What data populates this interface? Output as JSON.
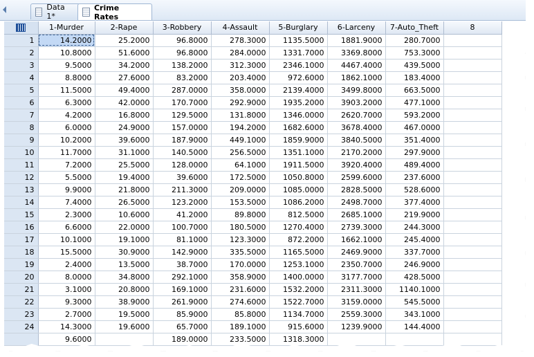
{
  "tabs": [
    {
      "label": "Data 1*"
    },
    {
      "label": "Crime Rates"
    }
  ],
  "columns": [
    "1-Murder",
    "2-Rape",
    "3-Robbery",
    "4-Assault",
    "5-Burglary",
    "6-Larceny",
    "7-Auto_Theft",
    "8"
  ],
  "rows": [
    {
      "n": "1",
      "v": [
        "14.2000",
        "25.2000",
        "96.8000",
        "278.3000",
        "1135.5000",
        "1881.9000",
        "280.7000",
        ""
      ]
    },
    {
      "n": "2",
      "v": [
        "10.8000",
        "51.6000",
        "96.8000",
        "284.0000",
        "1331.7000",
        "3369.8000",
        "753.3000",
        ""
      ]
    },
    {
      "n": "3",
      "v": [
        "9.5000",
        "34.2000",
        "138.2000",
        "312.3000",
        "2346.1000",
        "4467.4000",
        "439.5000",
        ""
      ]
    },
    {
      "n": "4",
      "v": [
        "8.8000",
        "27.6000",
        "83.2000",
        "203.4000",
        "972.6000",
        "1862.1000",
        "183.4000",
        ""
      ]
    },
    {
      "n": "5",
      "v": [
        "11.5000",
        "49.4000",
        "287.0000",
        "358.0000",
        "2139.4000",
        "3499.8000",
        "663.5000",
        ""
      ]
    },
    {
      "n": "6",
      "v": [
        "6.3000",
        "42.0000",
        "170.7000",
        "292.9000",
        "1935.2000",
        "3903.2000",
        "477.1000",
        ""
      ]
    },
    {
      "n": "7",
      "v": [
        "4.2000",
        "16.8000",
        "129.5000",
        "131.8000",
        "1346.0000",
        "2620.7000",
        "593.2000",
        ""
      ]
    },
    {
      "n": "8",
      "v": [
        "6.0000",
        "24.9000",
        "157.0000",
        "194.2000",
        "1682.6000",
        "3678.4000",
        "467.0000",
        ""
      ]
    },
    {
      "n": "9",
      "v": [
        "10.2000",
        "39.6000",
        "187.9000",
        "449.1000",
        "1859.9000",
        "3840.5000",
        "351.4000",
        ""
      ]
    },
    {
      "n": "10",
      "v": [
        "11.7000",
        "31.1000",
        "140.5000",
        "256.5000",
        "1351.1000",
        "2170.2000",
        "297.9000",
        ""
      ]
    },
    {
      "n": "11",
      "v": [
        "7.2000",
        "25.5000",
        "128.0000",
        "64.1000",
        "1911.5000",
        "3920.4000",
        "489.4000",
        ""
      ]
    },
    {
      "n": "12",
      "v": [
        "5.5000",
        "19.4000",
        "39.6000",
        "172.5000",
        "1050.8000",
        "2599.6000",
        "237.6000",
        ""
      ]
    },
    {
      "n": "13",
      "v": [
        "9.9000",
        "21.8000",
        "211.3000",
        "209.0000",
        "1085.0000",
        "2828.5000",
        "528.6000",
        ""
      ]
    },
    {
      "n": "14",
      "v": [
        "7.4000",
        "26.5000",
        "123.2000",
        "153.5000",
        "1086.2000",
        "2498.7000",
        "377.4000",
        ""
      ]
    },
    {
      "n": "15",
      "v": [
        "2.3000",
        "10.6000",
        "41.2000",
        "89.8000",
        "812.5000",
        "2685.1000",
        "219.9000",
        ""
      ]
    },
    {
      "n": "16",
      "v": [
        "6.6000",
        "22.0000",
        "100.7000",
        "180.5000",
        "1270.4000",
        "2739.3000",
        "244.3000",
        ""
      ]
    },
    {
      "n": "17",
      "v": [
        "10.1000",
        "19.1000",
        "81.1000",
        "123.3000",
        "872.2000",
        "1662.1000",
        "245.4000",
        ""
      ]
    },
    {
      "n": "18",
      "v": [
        "15.5000",
        "30.9000",
        "142.9000",
        "335.5000",
        "1165.5000",
        "2469.9000",
        "337.7000",
        ""
      ]
    },
    {
      "n": "19",
      "v": [
        "2.4000",
        "13.5000",
        "38.7000",
        "170.0000",
        "1253.1000",
        "2350.7000",
        "246.9000",
        ""
      ]
    },
    {
      "n": "20",
      "v": [
        "8.0000",
        "34.8000",
        "292.1000",
        "358.9000",
        "1400.0000",
        "3177.7000",
        "428.5000",
        ""
      ]
    },
    {
      "n": "21",
      "v": [
        "3.1000",
        "20.8000",
        "169.1000",
        "231.6000",
        "1532.2000",
        "2311.3000",
        "1140.1000",
        ""
      ]
    },
    {
      "n": "22",
      "v": [
        "9.3000",
        "38.9000",
        "261.9000",
        "274.6000",
        "1522.7000",
        "3159.0000",
        "545.5000",
        ""
      ]
    },
    {
      "n": "23",
      "v": [
        "2.7000",
        "19.5000",
        "85.9000",
        "85.8000",
        "1134.7000",
        "2559.3000",
        "343.1000",
        ""
      ]
    },
    {
      "n": "24",
      "v": [
        "14.3000",
        "19.6000",
        "65.7000",
        "189.1000",
        "915.6000",
        "1239.9000",
        "144.4000",
        ""
      ]
    },
    {
      "n": "",
      "v": [
        "9.6000",
        "",
        "189.0000",
        "233.5000",
        "1318.3000",
        "",
        "",
        ""
      ]
    }
  ],
  "selected_cell": {
    "row": 0,
    "col": 0
  }
}
